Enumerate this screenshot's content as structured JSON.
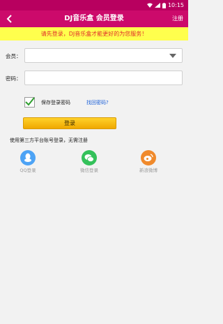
{
  "status_bar": {
    "time": "10:15"
  },
  "header": {
    "title": "DJ音乐盒 会员登录",
    "register_label": "注册"
  },
  "notice": "请先登录，DJ音乐盒才能更好的为您服务！",
  "form": {
    "member_label": "会员：",
    "member_value": "",
    "password_label": "密码：",
    "password_value": "",
    "save_password_label": "保存登录密码",
    "save_password_checked": true,
    "forgot_password_label": "找回密码?",
    "login_label": "登录"
  },
  "third_party": {
    "text": "使用第三方平台账号登录，无需注册",
    "options": [
      {
        "label": "QQ登录",
        "icon": "qq-icon",
        "color": "#4da3f5"
      },
      {
        "label": "微信登录",
        "icon": "wechat-icon",
        "color": "#34c15a"
      },
      {
        "label": "新浪微博",
        "icon": "weibo-icon",
        "color": "#f08a2c"
      }
    ]
  }
}
